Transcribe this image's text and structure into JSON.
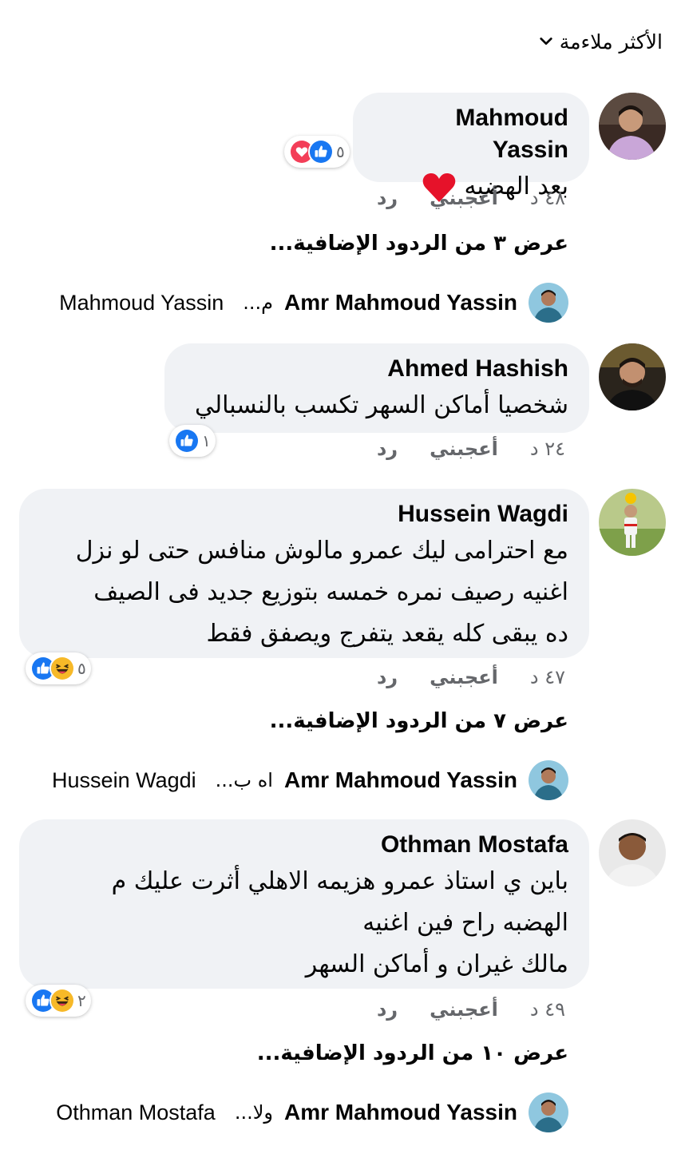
{
  "sort": {
    "label": "الأكثر ملاءمة"
  },
  "comments": [
    {
      "author": "Mahmoud Yassin",
      "text_lines": [
        "بعد الهضبه"
      ],
      "has_heart_emoji": true,
      "reactions": {
        "icons": [
          "heart-icon",
          "like-icon"
        ],
        "count": "٥"
      },
      "time": "٤٨ د",
      "like_label": "أعجبني",
      "reply_label": "رد",
      "more_replies": "عرض ٣ من الردود الإضافية...",
      "latest_reply": {
        "author": "Amr Mahmoud Yassin",
        "snippet": "م...",
        "to": "Mahmoud Yassin"
      }
    },
    {
      "author": "Ahmed Hashish",
      "text_lines": [
        "شخصيا أماكن السهر تكسب بالنسبالي"
      ],
      "reactions": {
        "icons": [
          "like-icon"
        ],
        "count": "١"
      },
      "time": "٢٤ د",
      "like_label": "أعجبني",
      "reply_label": "رد"
    },
    {
      "author": "Hussein Wagdi",
      "text_lines": [
        "مع احترامى ليك عمرو مالوش منافس حتى لو نزل",
        "اغنيه رصيف نمره خمسه بتوزيع جديد فى الصيف",
        "ده يبقى كله يقعد يتفرج ويصفق فقط"
      ],
      "reactions": {
        "icons": [
          "like-icon",
          "haha-icon"
        ],
        "count": "٥"
      },
      "time": "٤٧ د",
      "like_label": "أعجبني",
      "reply_label": "رد",
      "more_replies": "عرض ٧ من الردود الإضافية...",
      "latest_reply": {
        "author": "Amr Mahmoud Yassin",
        "snippet": "اه ب...",
        "to": "Hussein Wagdi"
      }
    },
    {
      "author": "Othman Mostafa",
      "text_lines": [
        "باين ي استاذ عمرو هزيمه الاهلي أثرت عليك م",
        "الهضبه راح فين اغنيه",
        "مالك غيران و أماكن السهر"
      ],
      "reactions": {
        "icons": [
          "like-icon",
          "haha-icon"
        ],
        "count": "٢"
      },
      "time": "٤٩ د",
      "like_label": "أعجبني",
      "reply_label": "رد",
      "more_replies": "عرض ١٠ من الردود الإضافية...",
      "latest_reply": {
        "author": "Amr Mahmoud Yassin",
        "snippet": "ولا...",
        "to": "Othman Mostafa"
      }
    }
  ],
  "colors": {
    "bubble": "#f0f2f5",
    "like_blue": "#1877f2",
    "heart_red": "#f33e58",
    "haha_yellow": "#f7b928",
    "meta_gray": "#65676b"
  }
}
